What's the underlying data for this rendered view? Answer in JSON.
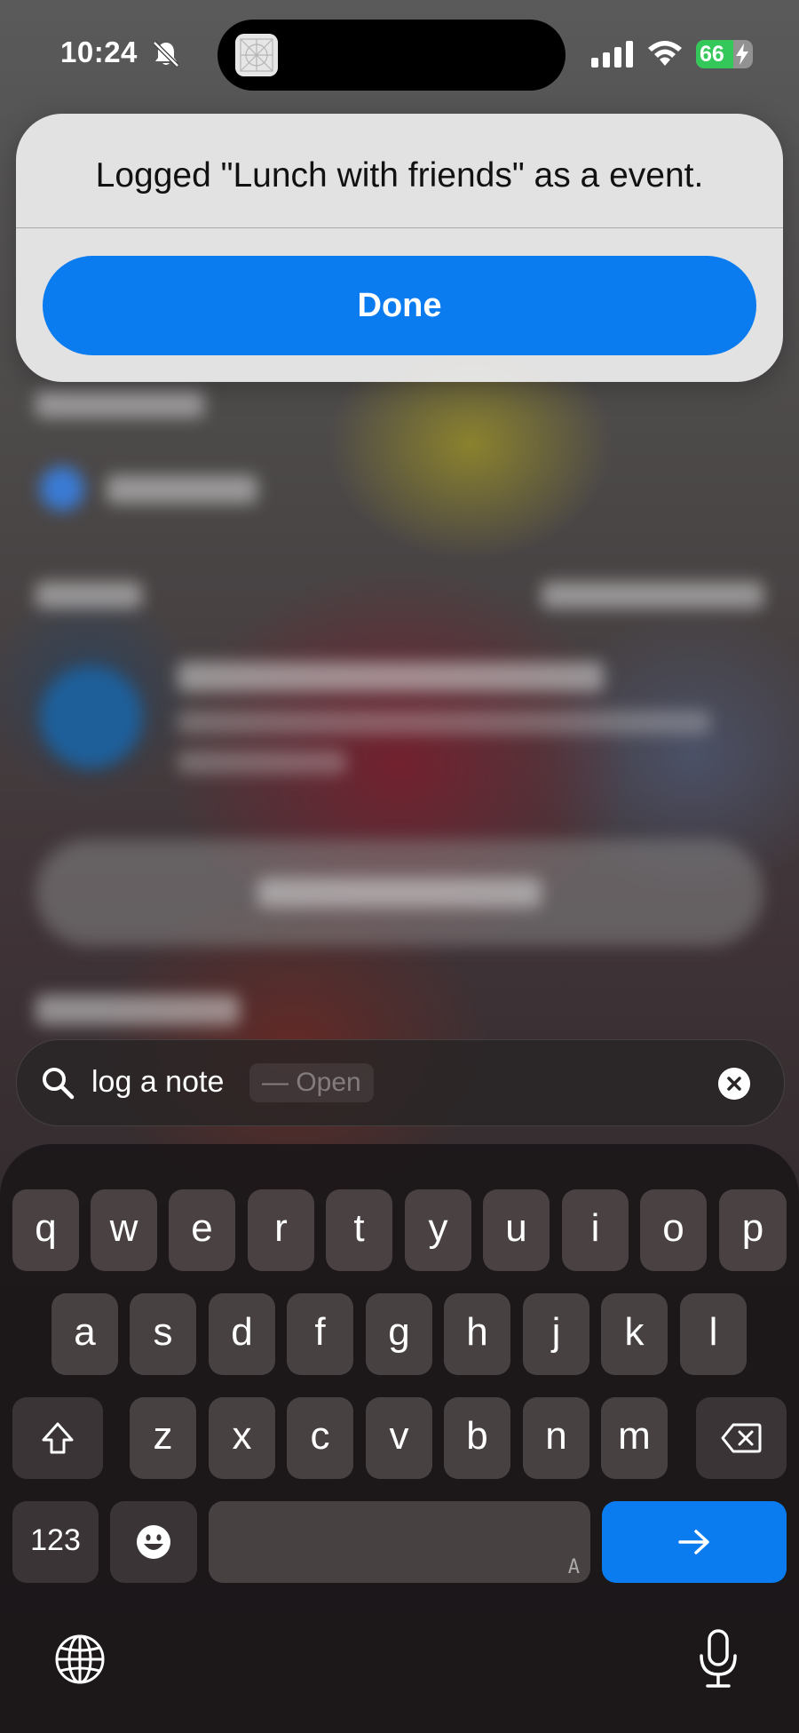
{
  "status_bar": {
    "time": "10:24",
    "battery_level": "66",
    "icons": [
      "bell-slash-icon",
      "cellular-signal-icon",
      "wifi-icon",
      "battery-charging-icon"
    ]
  },
  "dynamic_island": {
    "app_icon": "app-placeholder-icon"
  },
  "alert": {
    "message": "Logged \"Lunch with friends\" as a event.",
    "done_label": "Done"
  },
  "search": {
    "query": "log a note",
    "hint": "— Open",
    "icons": {
      "search": "magnifier-icon",
      "clear": "clear-x-icon"
    }
  },
  "keyboard": {
    "row1": [
      "q",
      "w",
      "e",
      "r",
      "t",
      "y",
      "u",
      "i",
      "o",
      "p"
    ],
    "row2": [
      "a",
      "s",
      "d",
      "f",
      "g",
      "h",
      "j",
      "k",
      "l"
    ],
    "row3": [
      "z",
      "x",
      "c",
      "v",
      "b",
      "n",
      "m"
    ],
    "numbers_label": "123",
    "space_hint": "A",
    "icons": {
      "shift": "shift-arrow-icon",
      "delete": "backspace-icon",
      "emoji": "emoji-icon",
      "go": "arrow-right-icon",
      "globe": "globe-icon",
      "mic": "microphone-icon"
    },
    "colors": {
      "accent": "#0a7cf0"
    }
  }
}
